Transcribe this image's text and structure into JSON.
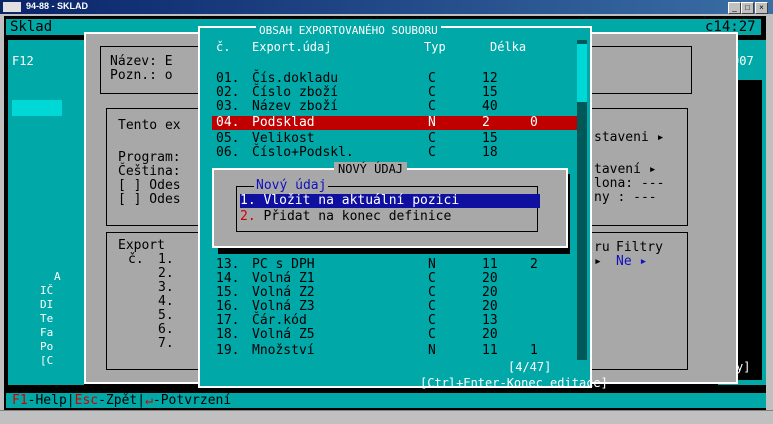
{
  "window": {
    "title": "94-88 - SKLAD"
  },
  "console": {
    "app_name": "Sklad",
    "clock": "c14:27",
    "left_label": "F12",
    "right_label": "007",
    "right_bottom": "y]"
  },
  "main_dialog": {
    "name_label": "Název: E",
    "note_label": "Pozn.: o",
    "tento": "Tento ex",
    "program": "Program:",
    "cestina": "Čeština:",
    "ode1": "[ ] Odes",
    "ode2": "[ ] Odes",
    "nastaveni1": "staveni ▸",
    "nastaveni2": "tavení ▸",
    "nastaveni3": "lona: ---",
    "nastaveni4": "ny  : ---",
    "export_label": "Export",
    "cislo_label": "č.",
    "export_numbers": [
      "1.",
      "2.",
      "3.",
      "4.",
      "5.",
      "6.",
      "7."
    ],
    "filtry": "Filtry",
    "ne": "Ne  ▸",
    "ru": "ru",
    "arrow": "▸"
  },
  "left_rows": [
    "A",
    "IČ",
    "DI",
    "Te",
    "Fa",
    "Po",
    "[C"
  ],
  "export_dialog": {
    "title": "OBSAH EXPORTOVANÉHO SOUBORU",
    "columns": {
      "num": "č.",
      "name": "Export.údaj",
      "type": "Typ",
      "length": "Délka"
    },
    "rows": [
      {
        "n": "01.",
        "name": "Čís.dokladu",
        "type": "C",
        "len": "12",
        "dec": ""
      },
      {
        "n": "02.",
        "name": "Číslo zboží",
        "type": "C",
        "len": "15",
        "dec": ""
      },
      {
        "n": "03.",
        "name": "Název zboží",
        "type": "C",
        "len": "40",
        "dec": ""
      },
      {
        "n": "04.",
        "name": "Podsklad",
        "type": "N",
        "len": "2",
        "dec": "0"
      },
      {
        "n": "05.",
        "name": "Velikost",
        "type": "C",
        "len": "15",
        "dec": ""
      },
      {
        "n": "06.",
        "name": "Číslo+Podskl.",
        "type": "C",
        "len": "18",
        "dec": ""
      },
      {
        "n": "13.",
        "name": "PC s DPH",
        "type": "N",
        "len": "11",
        "dec": "2"
      },
      {
        "n": "14.",
        "name": "Volná Z1",
        "type": "C",
        "len": "20",
        "dec": ""
      },
      {
        "n": "15.",
        "name": "Volná Z2",
        "type": "C",
        "len": "20",
        "dec": ""
      },
      {
        "n": "16.",
        "name": "Volná Z3",
        "type": "C",
        "len": "20",
        "dec": ""
      },
      {
        "n": "17.",
        "name": "Čár.kód",
        "type": "C",
        "len": "13",
        "dec": ""
      },
      {
        "n": "18.",
        "name": "Volná Z5",
        "type": "C",
        "len": "20",
        "dec": ""
      },
      {
        "n": "19.",
        "name": "Množství",
        "type": "N",
        "len": "11",
        "dec": "1"
      }
    ],
    "counter": "[4/47]",
    "hint": "[Ctrl+Enter-Konec editace]"
  },
  "modal": {
    "title": "NOVÝ ÚDAJ",
    "label": "Nový údaj",
    "options": [
      {
        "num": "1.",
        "text": "Vložit na aktuální pozici"
      },
      {
        "num": "2.",
        "text": "Přidat na konec definice"
      }
    ]
  },
  "statusbar": {
    "f1_key": "F1",
    "f1_text": "-Help|",
    "esc_key": "Esc",
    "esc_text": "-Zpět|",
    "enter_key": "↵",
    "enter_text": "-Potvrzení"
  },
  "colors": {
    "cyan": "#00a8a8",
    "gray": "#a8a8a8",
    "highlight_red": "#c00000",
    "selection_blue": "#1010a0"
  }
}
